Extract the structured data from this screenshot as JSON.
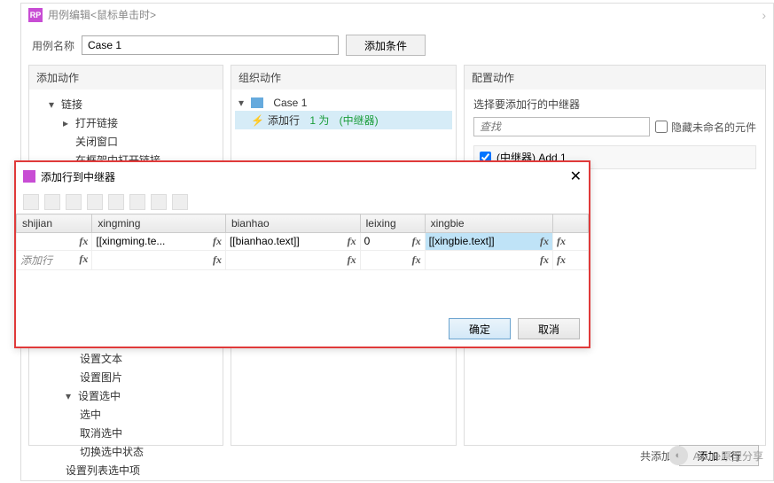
{
  "dialog": {
    "title": "用例编辑<鼠标单击时>",
    "case_label": "用例名称",
    "case_value": "Case 1",
    "add_condition": "添加条件"
  },
  "panels": {
    "add": "添加动作",
    "org": "组织动作",
    "cfg": "配置动作"
  },
  "actions_tree": {
    "links": "链接",
    "open_link": "打开链接",
    "close_window": "关闭窗口",
    "open_in_frame": "在框架中打开链接",
    "set_text": "设置文本",
    "set_image": "设置图片",
    "set_selected_group": "设置选中",
    "selected": "选中",
    "unselect": "取消选中",
    "toggle": "切换选中状态",
    "set_list_selected": "设置列表选中项"
  },
  "org_tree": {
    "case": "Case 1",
    "action_prefix": "添加行",
    "action_mid": "1 为",
    "action_suffix": "(中继器)"
  },
  "config": {
    "header": "选择要添加行的中继器",
    "search_placeholder": "查找",
    "hide_unnamed": "隐藏未命名的元件",
    "item": "(中继器) Add 1"
  },
  "sub": {
    "title": "添加行到中继器",
    "ok": "确定",
    "cancel": "取消",
    "cols": [
      "shijian",
      "xingming",
      "bianhao",
      "leixing",
      "xingbie",
      ""
    ],
    "row1": [
      "",
      "[[xingming.te...",
      "[[bianhao.text]]",
      "0",
      "",
      "[[xingbie.text]]"
    ],
    "add_row_label": "添加行",
    "fx": "fx"
  },
  "footer": {
    "text": "共添加",
    "btn": "添加 1 行"
  },
  "watermark": "Axure原型分享"
}
